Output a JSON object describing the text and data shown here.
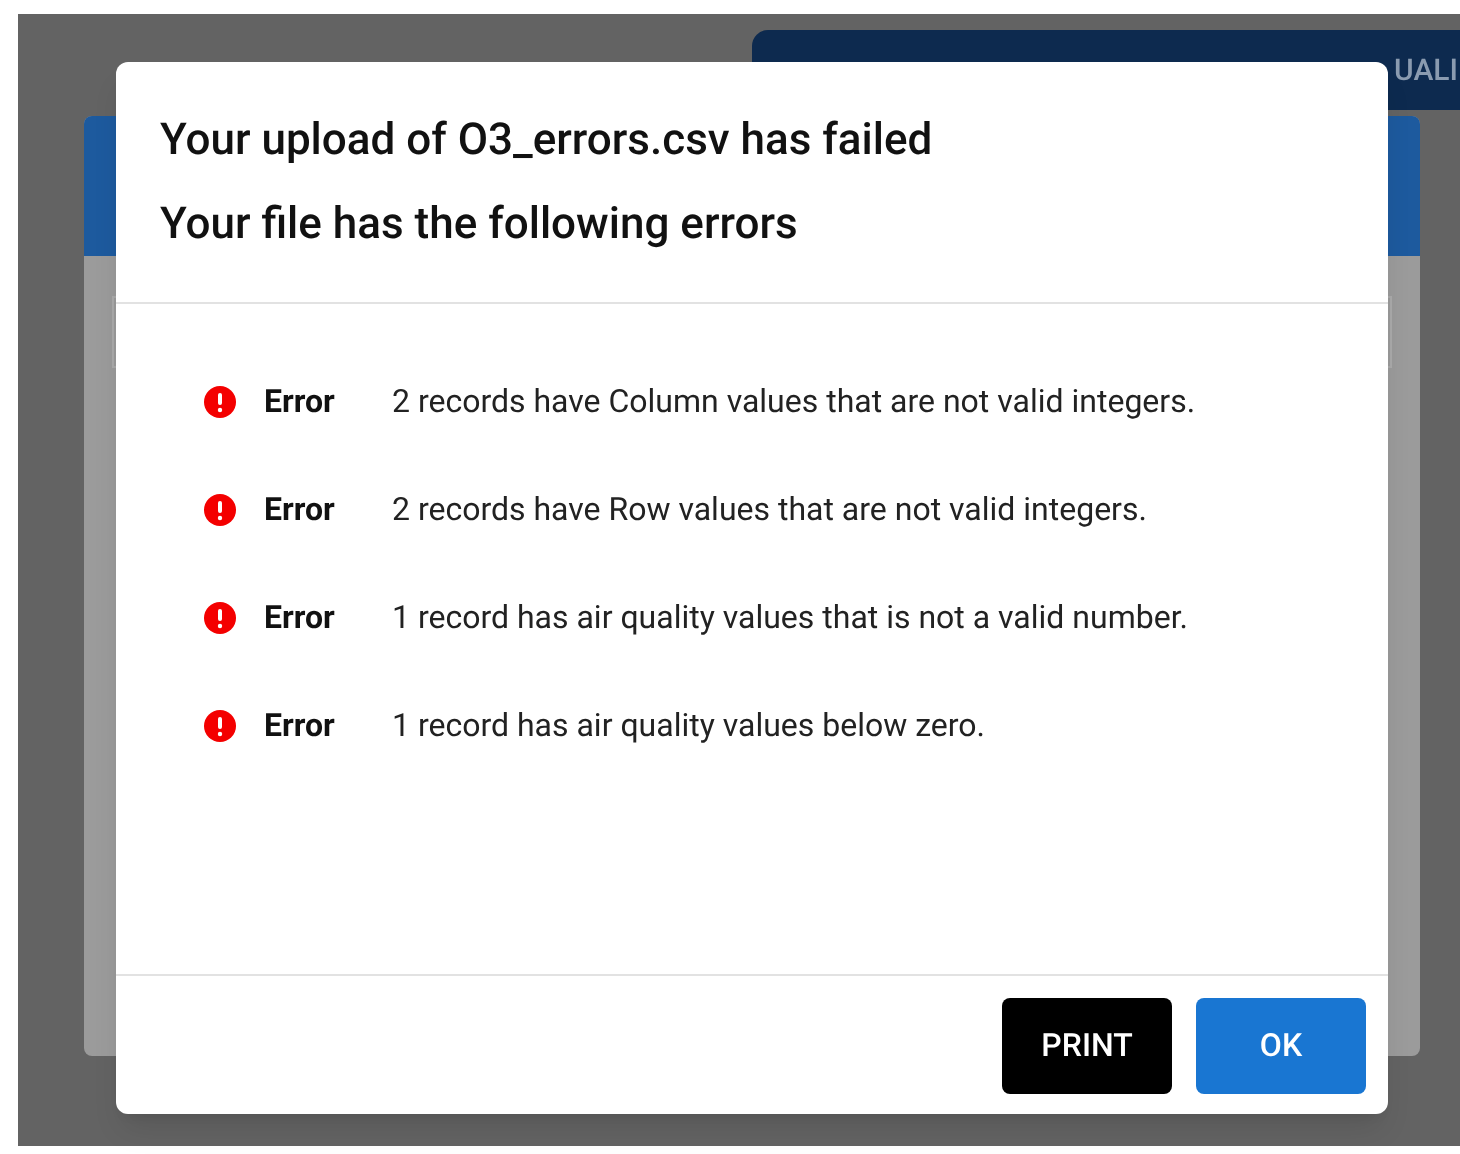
{
  "background_button": {
    "label": "UALI"
  },
  "dialog": {
    "title_lines": [
      "Your upload of O3_errors.csv has failed",
      "Your file has the following errors"
    ],
    "errors": [
      {
        "label": "Error",
        "message": "2 records have Column values that are not valid integers."
      },
      {
        "label": "Error",
        "message": "2 records have Row values that are not valid integers."
      },
      {
        "label": "Error",
        "message": "1 record has air quality values that is not a valid number."
      },
      {
        "label": "Error",
        "message": "1 record has air quality values below zero."
      }
    ],
    "buttons": [
      {
        "label": "PRINT",
        "kind": "print"
      },
      {
        "label": "OK",
        "kind": "ok"
      }
    ]
  }
}
